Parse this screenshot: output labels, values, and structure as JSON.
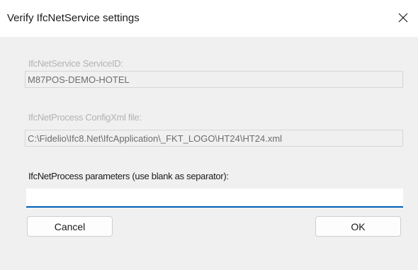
{
  "window": {
    "title": "Verify IfcNetService settings",
    "close_icon": "close-icon"
  },
  "service_id": {
    "label": "IfcNetService ServiceID:",
    "value": "M87POS-DEMO-HOTEL"
  },
  "config_file": {
    "label": "IfcNetProcess ConfigXml file:",
    "value": "C:\\Fidelio\\Ifc8.Net\\IfcApplication\\_FKT_LOGO\\HT24\\HT24.xml"
  },
  "parameters": {
    "label": "IfcNetProcess parameters (use blank as separator):",
    "value": ""
  },
  "buttons": {
    "cancel_label": "Cancel",
    "ok_label": "OK"
  },
  "colors": {
    "accent": "#005fb8",
    "disabled_text": "#b3b3b3",
    "background": "#f0f0f0"
  }
}
